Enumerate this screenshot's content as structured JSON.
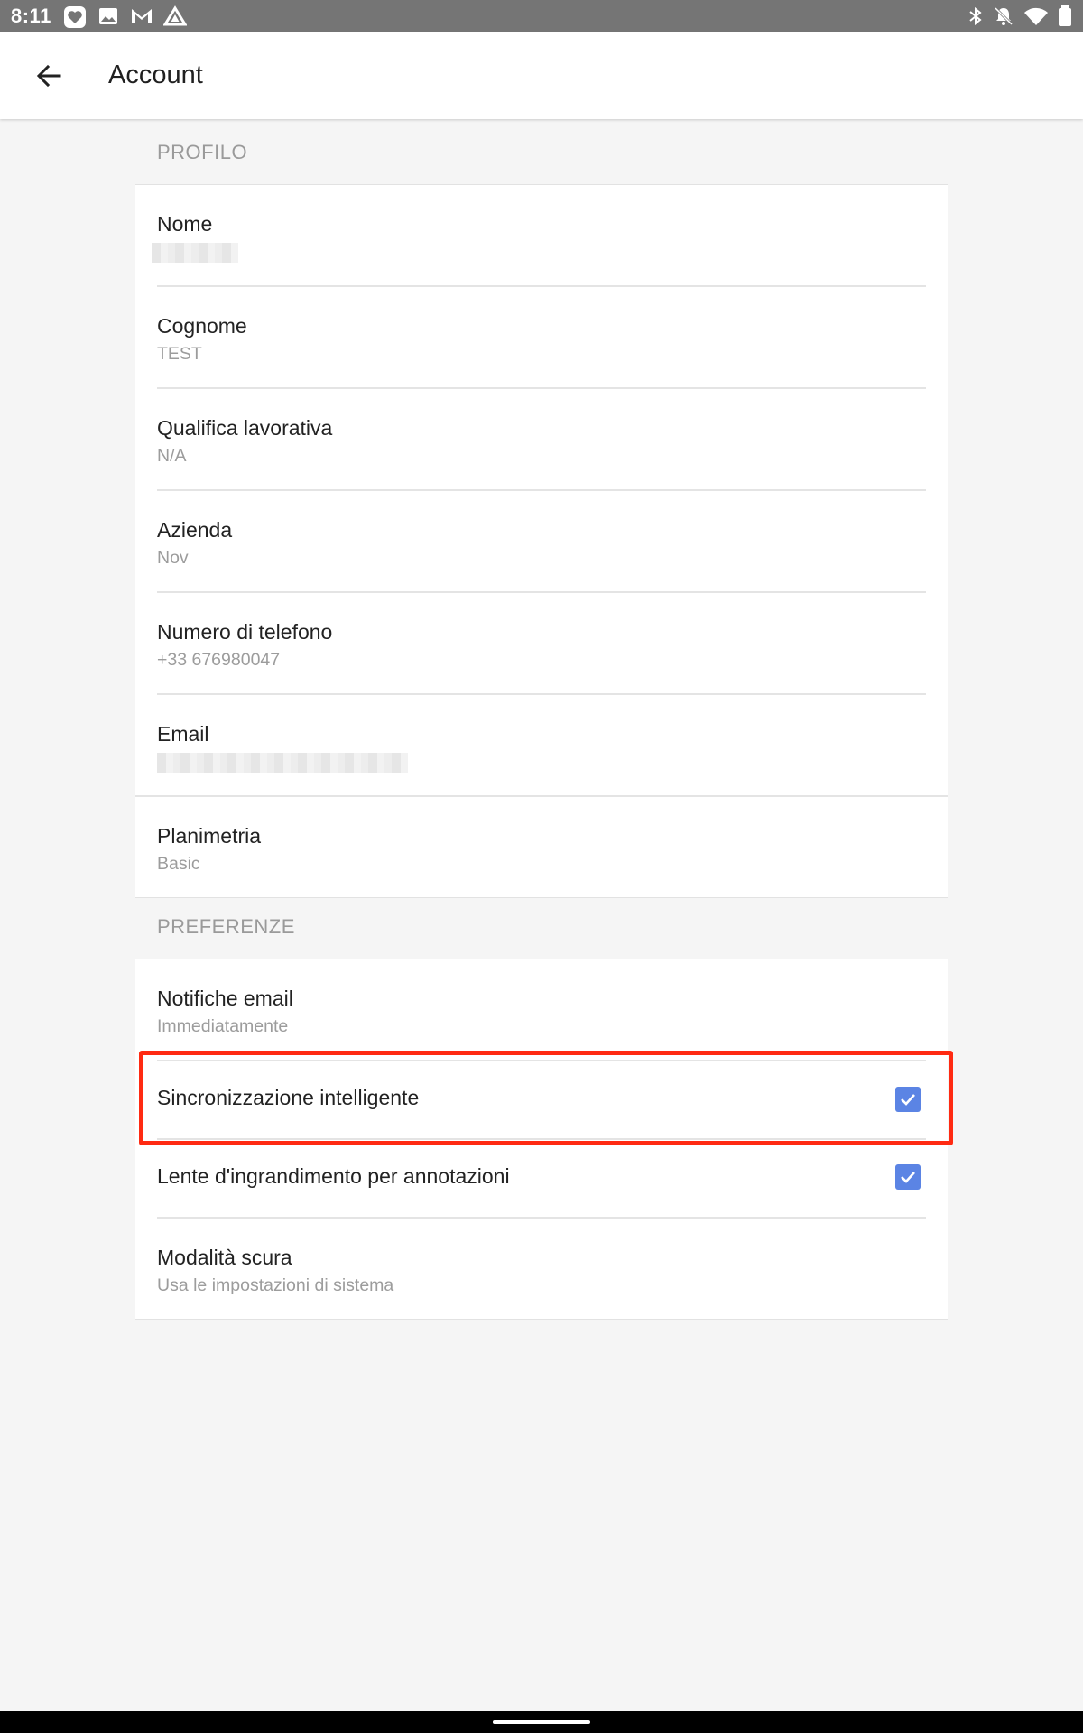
{
  "status_bar": {
    "time": "8:11",
    "left_icons": [
      "heart-app-icon",
      "image-icon",
      "gmail-icon",
      "drive-icon"
    ],
    "right_icons": [
      "bluetooth-icon",
      "notifications-off-icon",
      "wifi-icon",
      "battery-icon"
    ]
  },
  "app_bar": {
    "title": "Account",
    "back_icon": "arrow-back-icon"
  },
  "sections": {
    "profile": {
      "header": "PROFILO",
      "rows": [
        {
          "label": "Nome",
          "value": ""
        },
        {
          "label": "Cognome",
          "value": "TEST"
        },
        {
          "label": "Qualifica lavorativa",
          "value": "N/A"
        },
        {
          "label": "Azienda",
          "value": "Nov"
        },
        {
          "label": "Numero di telefono",
          "value": "+33 676980047"
        },
        {
          "label": "Email",
          "value": ""
        },
        {
          "label": "Planimetria",
          "value": "Basic"
        }
      ]
    },
    "preferences": {
      "header": "PREFERENZE",
      "rows": [
        {
          "label": "Notifiche email",
          "value": "Immediatamente"
        },
        {
          "label": "Sincronizzazione intelligente",
          "checked": true
        },
        {
          "label": "Lente d'ingrandimento per annotazioni",
          "checked": true
        },
        {
          "label": "Modalità scura",
          "value": "Usa le impostazioni di sistema"
        }
      ]
    }
  },
  "colors": {
    "accent": "#5b84e4",
    "highlight": "#ff2a12",
    "status_bar": "#757575"
  }
}
